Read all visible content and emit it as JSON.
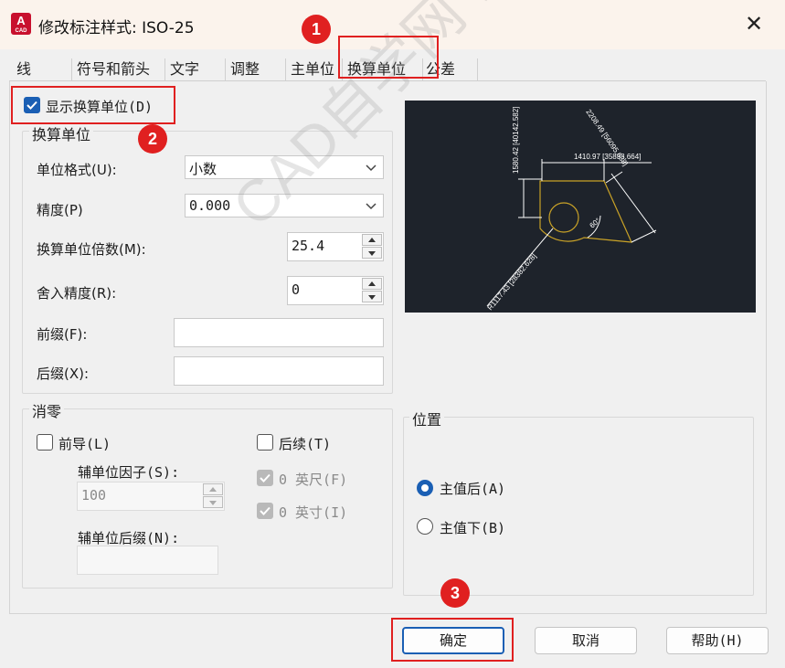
{
  "window": {
    "title": "修改标注样式: ISO-25",
    "app_icon_letter": "A",
    "app_icon_caption": "CAD"
  },
  "tabs": [
    {
      "label": "线"
    },
    {
      "label": "符号和箭头"
    },
    {
      "label": "文字"
    },
    {
      "label": "调整"
    },
    {
      "label": "主单位"
    },
    {
      "label": "换算单位",
      "active": true
    },
    {
      "label": "公差"
    }
  ],
  "display_alt_units": {
    "label": "显示换算单位(D)",
    "checked": true
  },
  "alt_units": {
    "group_label": "换算单位",
    "unit_format": {
      "label": "单位格式(U):",
      "value": "小数"
    },
    "precision": {
      "label": "精度(P)",
      "value": "0.000"
    },
    "multiplier": {
      "label": "换算单位倍数(M):",
      "value": "25.4"
    },
    "round_off": {
      "label": "舍入精度(R):",
      "value": "0"
    },
    "prefix": {
      "label": "前缀(F):",
      "value": ""
    },
    "suffix": {
      "label": "后缀(X):",
      "value": ""
    }
  },
  "zero_suppression": {
    "group_label": "消零",
    "leading": {
      "label": "前导(L)",
      "checked": false
    },
    "trailing": {
      "label": "后续(T)",
      "checked": false
    },
    "sub_unit_factor": {
      "label": "辅单位因子(S):",
      "value": "100"
    },
    "sub_unit_suffix": {
      "label": "辅单位后缀(N):",
      "value": ""
    },
    "zero_feet": {
      "label": "0 英尺(F)",
      "checked": true,
      "disabled": true
    },
    "zero_inches": {
      "label": "0 英寸(I)",
      "checked": true,
      "disabled": true
    }
  },
  "placement": {
    "group_label": "位置",
    "after_primary": {
      "label": "主值后(A)",
      "selected": true
    },
    "below_primary": {
      "label": "主值下(B)",
      "selected": false
    }
  },
  "preview": {
    "dim_top": "1410.97 [35838.664]",
    "dim_left": "1580.42 [40142.582]",
    "dim_angled": "2208.49 [56095.638]",
    "dim_radius": "R1117.43 [28382.628]",
    "angle": "60°"
  },
  "buttons": {
    "ok": "确定",
    "cancel": "取消",
    "help": "帮助(H)"
  },
  "annotations": {
    "step1": "1",
    "step2": "2",
    "step3": "3"
  },
  "watermark": "CAD自学网 www.cadzxw.com",
  "colors": {
    "accent": "#1a5fb4",
    "annotation_red": "#e02020",
    "preview_bg": "#1e232b",
    "preview_shape": "#c9a227"
  }
}
